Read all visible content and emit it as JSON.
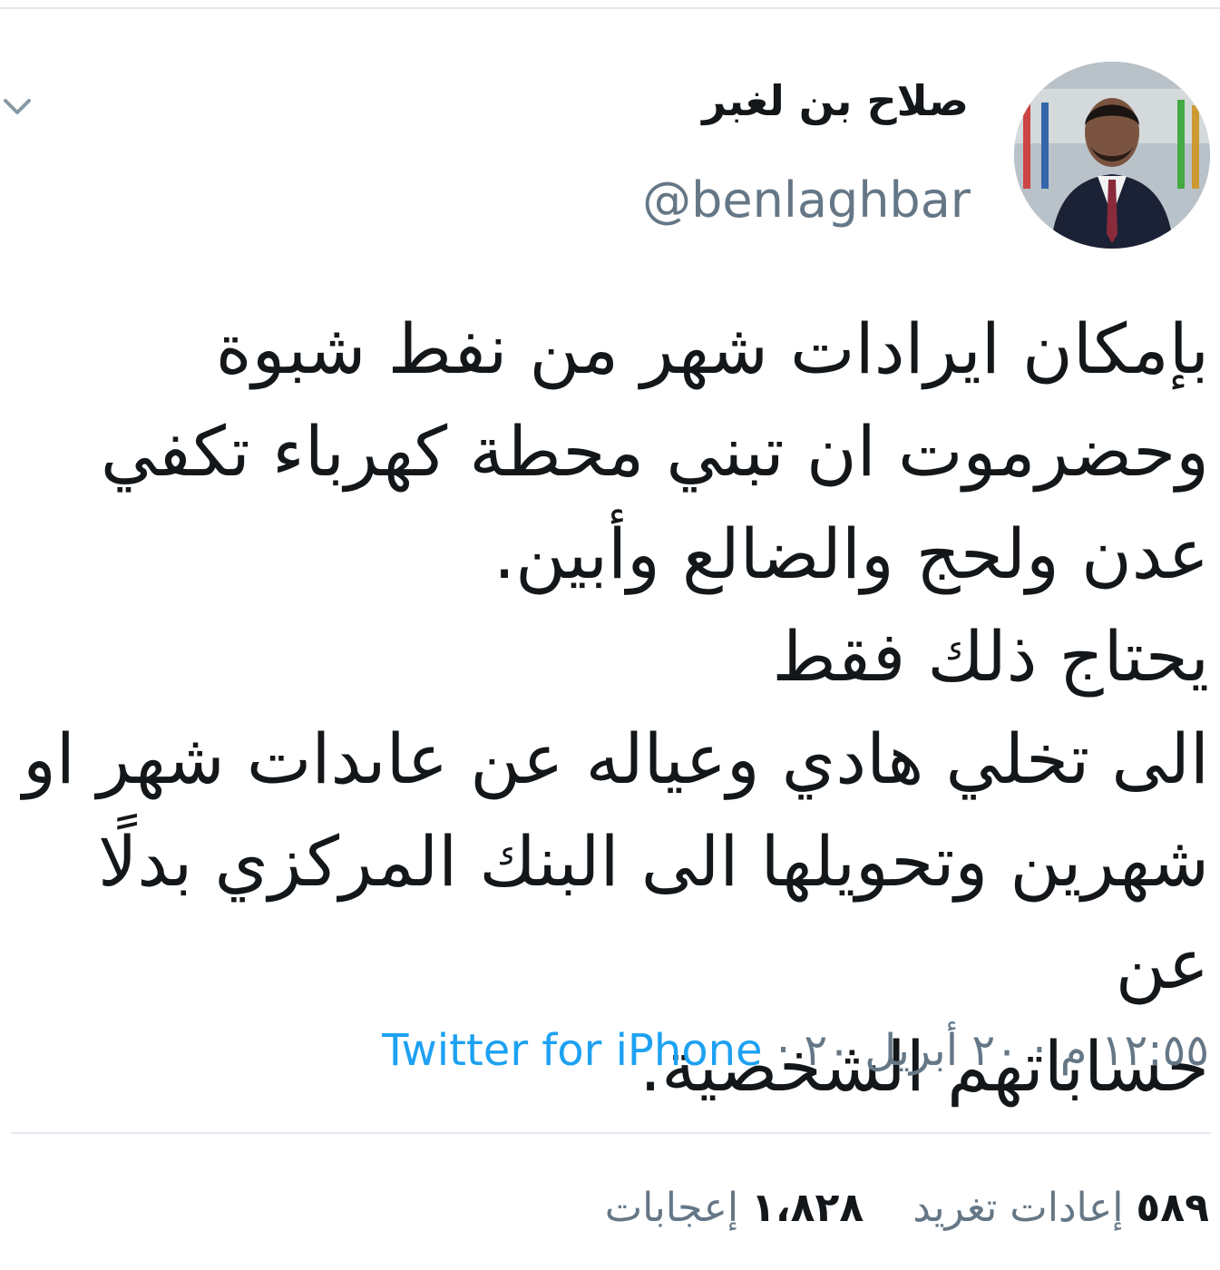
{
  "tweet": {
    "display_name": "صلاح بن لغبر",
    "handle": "@benlaghbar",
    "body": "بإمكان ايرادات شهر من نفط شبوة\nوحضرموت ان تبني محطة كهرباء تكفي\nعدن ولحج والضالع وأبين.\nيحتاج ذلك فقط\nالى تخلي هادي وعياله عن عاىدات شهر او\nشهرين وتحويلها الى البنك المركزي بدلًا عن\nحساباتهم الشخصية.",
    "time": "١٢:٥٥ م",
    "date": "٢٠ أبريل ٢٠",
    "separator": "·",
    "source": "Twitter for iPhone",
    "retweets_count": "٥٨٩",
    "retweets_label": "إعادات تغريد",
    "likes_count": "١،٨٢٨",
    "likes_label": "إعجابات"
  },
  "icons": {
    "menu": "chevron-down-icon",
    "avatar": "profile-photo"
  },
  "colors": {
    "link": "#1da1f2",
    "secondary_text": "#657786",
    "divider": "#e1e8ed"
  }
}
